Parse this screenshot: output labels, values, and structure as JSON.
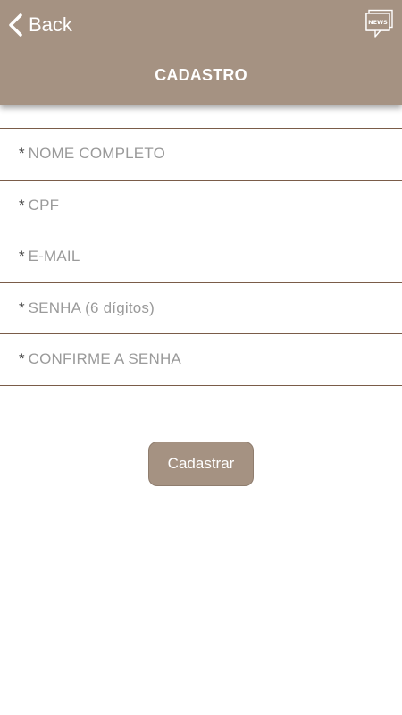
{
  "header": {
    "back_label": "Back",
    "title": "CADASTRO",
    "news_icon_text": "NEWS",
    "background_color": "#a59282"
  },
  "form": {
    "fields": [
      {
        "required_mark": "*",
        "placeholder": "NOME COMPLETO",
        "value": ""
      },
      {
        "required_mark": "*",
        "placeholder": "CPF",
        "value": ""
      },
      {
        "required_mark": "*",
        "placeholder": "E-MAIL",
        "value": ""
      },
      {
        "required_mark": "*",
        "placeholder": "SENHA (6 dígitos)",
        "value": ""
      },
      {
        "required_mark": "*",
        "placeholder": "CONFIRME A SENHA",
        "value": ""
      }
    ],
    "divider_color": "#7a5c49"
  },
  "submit": {
    "label": "Cadastrar",
    "background_color": "#a59282"
  }
}
